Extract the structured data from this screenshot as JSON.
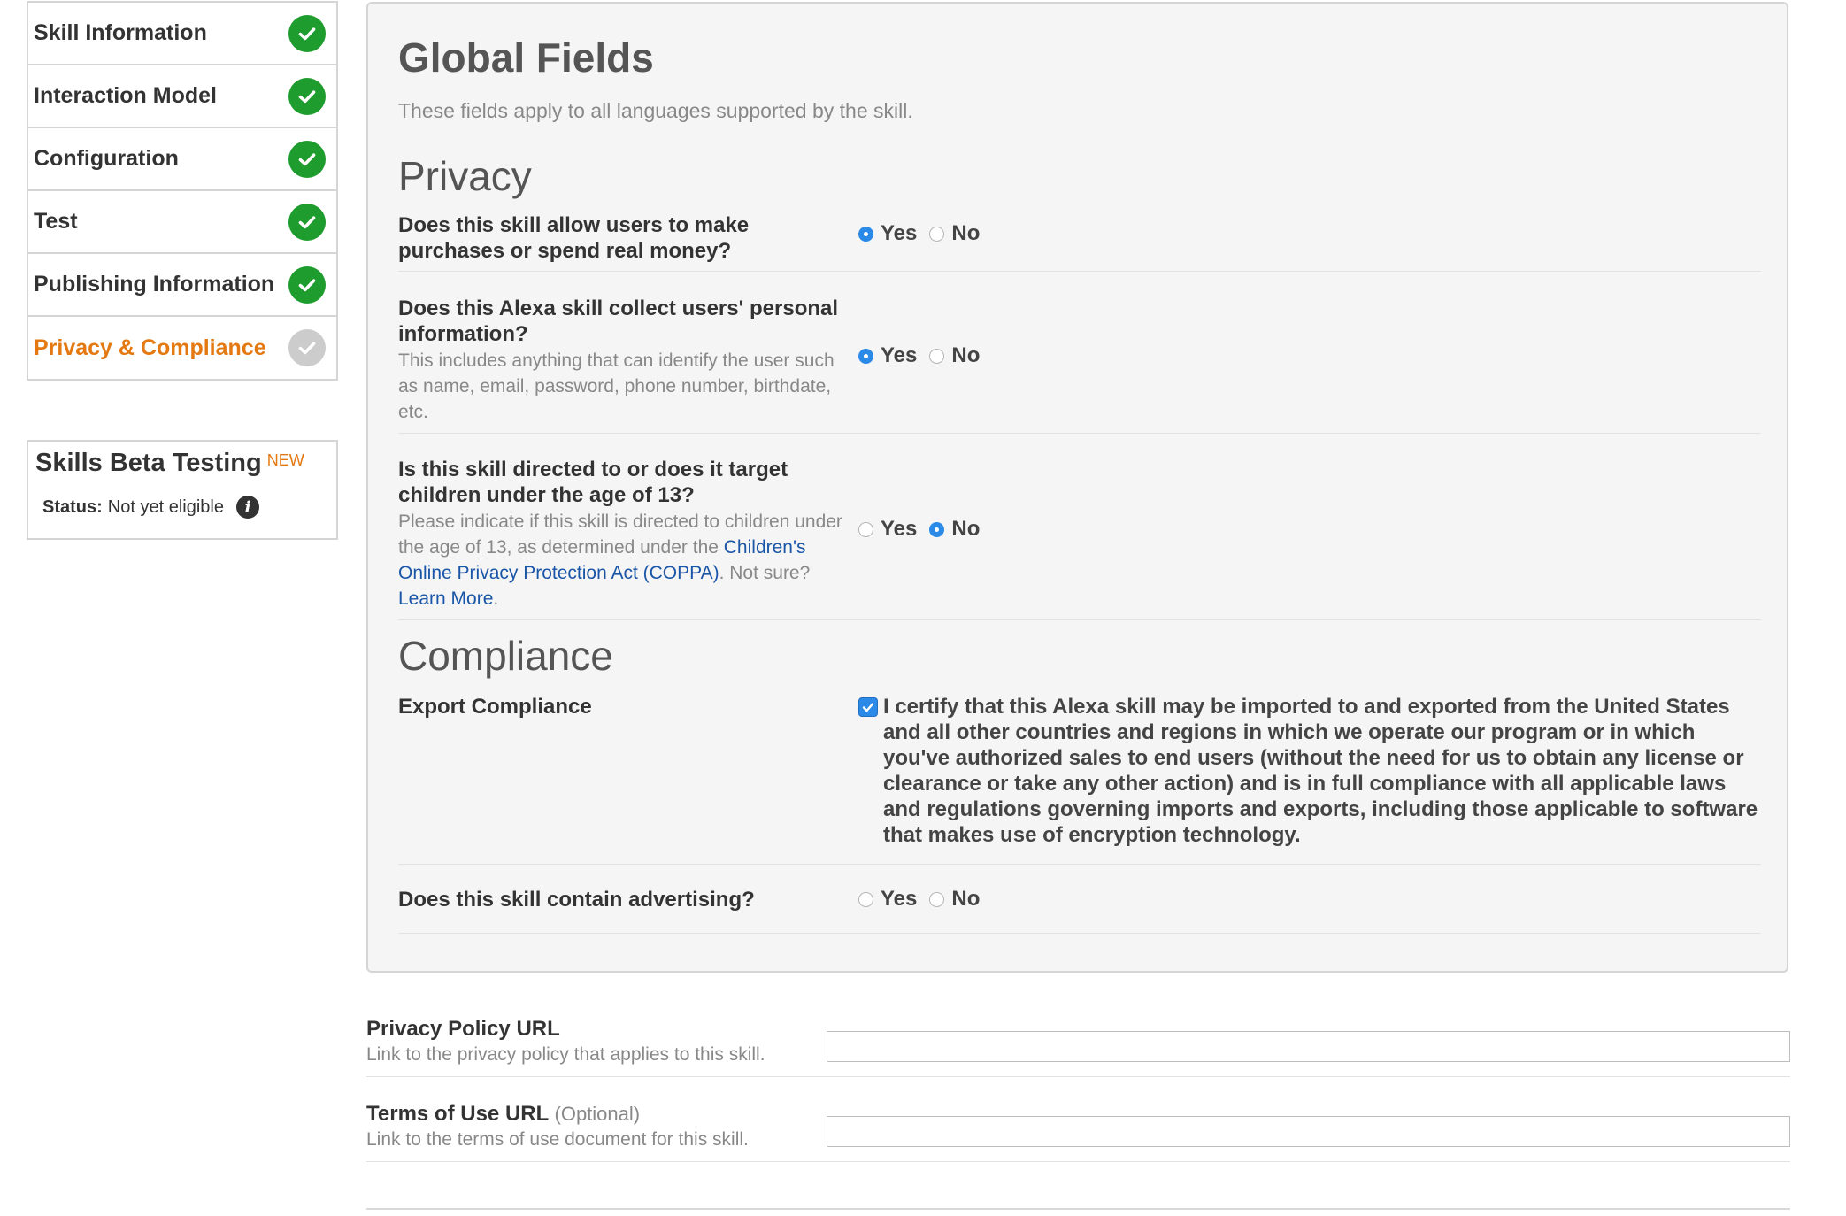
{
  "sidebar": {
    "items": [
      {
        "label": "Skill Information",
        "status": "complete"
      },
      {
        "label": "Interaction Model",
        "status": "complete"
      },
      {
        "label": "Configuration",
        "status": "complete"
      },
      {
        "label": "Test",
        "status": "complete"
      },
      {
        "label": "Publishing Information",
        "status": "complete"
      },
      {
        "label": "Privacy & Compliance",
        "status": "pending",
        "active": true
      }
    ],
    "beta": {
      "title": "Skills Beta Testing",
      "badge": "NEW",
      "status_label": "Status:",
      "status_value": "Not yet eligible",
      "info_glyph": "i"
    }
  },
  "global": {
    "title": "Global Fields",
    "subtitle": "These fields apply to all languages supported by the skill.",
    "privacy_heading": "Privacy",
    "compliance_heading": "Compliance",
    "yes_label": "Yes",
    "no_label": "No",
    "q1": {
      "label": "Does this skill allow users to make purchases or spend real money?",
      "selected": "Yes"
    },
    "q2": {
      "label": "Does this Alexa skill collect users' personal information?",
      "help": "This includes anything that can identify the user such as name, email, password, phone number, birthdate, etc.",
      "selected": "Yes"
    },
    "q3": {
      "label": "Is this skill directed to or does it target children under the age of 13?",
      "help_prefix": "Please indicate if this skill is directed to children under the age of 13, as determined under the ",
      "help_link": "Children's Online Privacy Protection Act (COPPA)",
      "help_mid": ". Not sure? ",
      "help_link2": "Learn More",
      "help_suffix": ".",
      "selected": "No"
    },
    "export": {
      "label": "Export Compliance",
      "checked": true,
      "text": "I certify that this Alexa skill may be imported to and exported from the United States and all other countries and regions in which we operate our program or in which you've authorized sales to end users (without the need for us to obtain any license or clearance or take any other action) and is in full compliance with all applicable laws and regulations governing imports and exports, including those applicable to software that makes use of encryption technology."
    },
    "ads": {
      "label": "Does this skill contain advertising?",
      "selected": null
    }
  },
  "urls": {
    "privacy": {
      "label": "Privacy Policy URL",
      "help": "Link to the privacy policy that applies to this skill.",
      "value": ""
    },
    "terms": {
      "label": "Terms of Use URL",
      "optional": "(Optional)",
      "help": "Link to the terms of use document for this skill.",
      "value": ""
    }
  },
  "colors": {
    "accent_orange": "#e47911",
    "check_green": "#1f9c2e",
    "radio_blue": "#2b8ae8",
    "link_blue": "#1a56a7"
  },
  "icons": {
    "complete": "check-circle-icon",
    "pending": "check-circle-pending-icon",
    "info": "info-icon"
  }
}
